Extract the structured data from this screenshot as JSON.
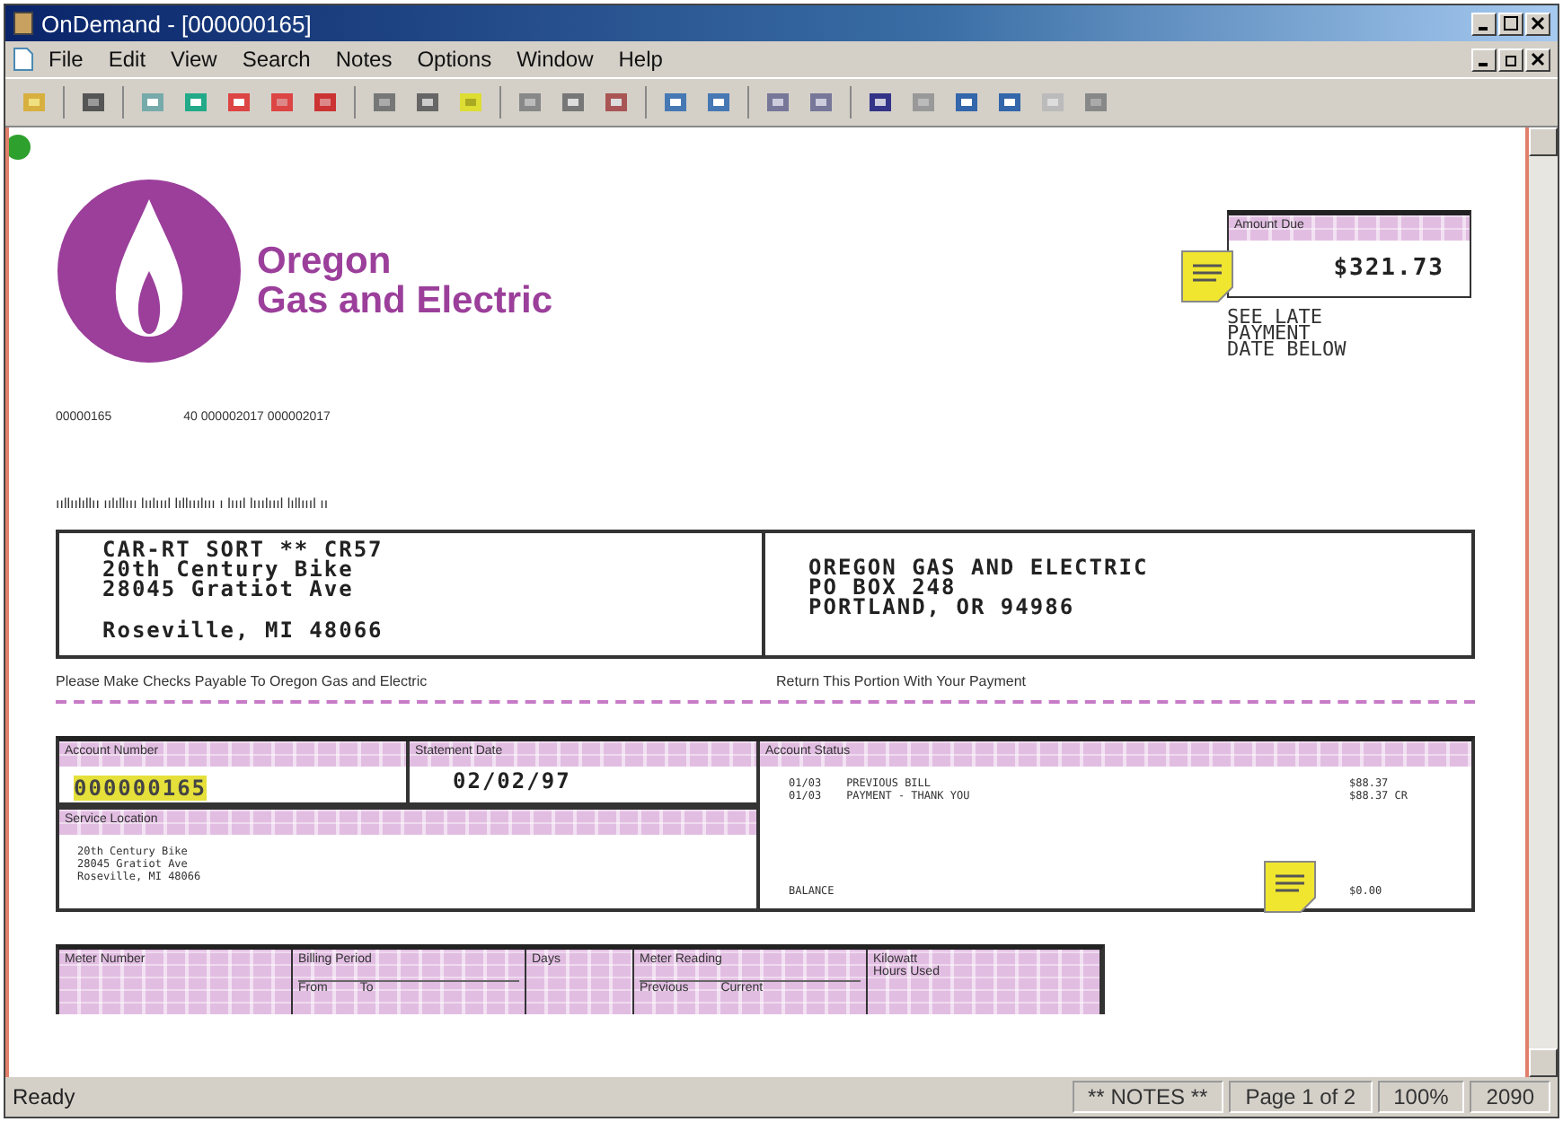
{
  "window": {
    "title": "OnDemand - [000000165]"
  },
  "menu": [
    "File",
    "Edit",
    "View",
    "Search",
    "Notes",
    "Options",
    "Window",
    "Help"
  ],
  "bill": {
    "company": [
      "Oregon",
      "Gas and Electric"
    ],
    "ref_numbers": [
      "00000165",
      "40 000002017 000002017"
    ],
    "barcode_line": "ııllıılıllıı ıılıllııı lıılıııl lıllııılııı ı lıııl lııılıııl lıllıııl ıı",
    "amount_due": {
      "label": "Amount Due",
      "value": "$321.73"
    },
    "late_notice": [
      "SEE LATE",
      "PAYMENT",
      "DATE BELOW"
    ],
    "customer_address": [
      "CAR-RT SORT    **    CR57",
      "20th Century Bike",
      "28045 Gratiot Ave",
      "Roseville, MI  48066"
    ],
    "remit_address": [
      "OREGON GAS AND ELECTRIC",
      "PO BOX 248",
      "PORTLAND, OR 94986"
    ],
    "payable_note": "Please Make Checks Payable To Oregon Gas and Electric",
    "return_note": "Return This Portion With Your Payment",
    "account_number": {
      "label": "Account Number",
      "value": "000000165"
    },
    "statement_date": {
      "label": "Statement Date",
      "value": "02/02/97"
    },
    "service_location": {
      "label": "Service Location",
      "lines": [
        "20th Century Bike",
        "28045 Gratiot Ave",
        "Roseville, MI  48066"
      ]
    },
    "account_status": {
      "label": "Account Status",
      "rows": [
        {
          "date": "01/03",
          "text": "PREVIOUS BILL",
          "amount": "$88.37"
        },
        {
          "date": "01/03",
          "text": "PAYMENT - THANK YOU",
          "amount": "$88.37 CR"
        }
      ],
      "balance_label": "BALANCE",
      "balance": "$0.00"
    },
    "meter_table": {
      "meter_number": "Meter Number",
      "billing_period": "Billing Period",
      "from": "From",
      "to": "To",
      "days": "Days",
      "meter_reading": "Meter Reading",
      "previous": "Previous",
      "current": "Current",
      "kwh": [
        "Kilowatt",
        "Hours Used"
      ]
    }
  },
  "status_bar": {
    "text": "Ready",
    "notes": "** NOTES **",
    "page": "Page 1 of 2",
    "zoom": "100%",
    "number": "2090"
  }
}
